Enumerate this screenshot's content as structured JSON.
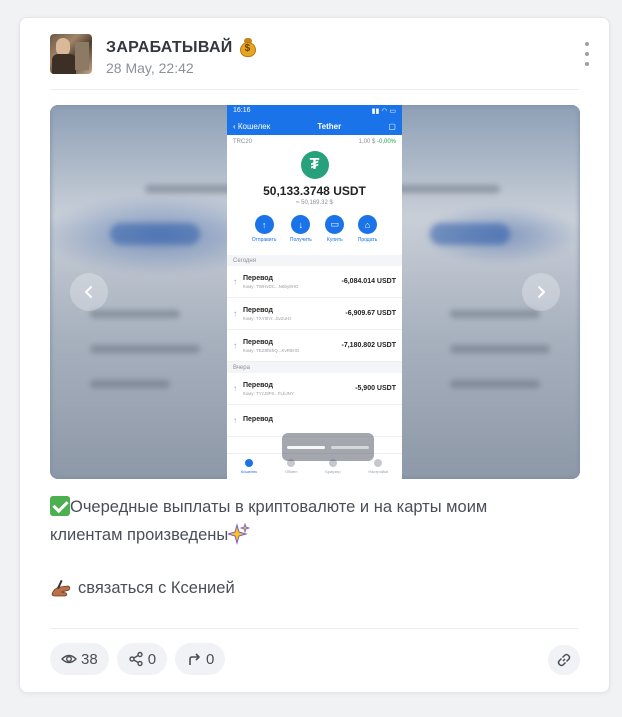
{
  "post": {
    "channel_name": "ЗАРАБАТЫВАЙ",
    "date": "28 May, 22:42",
    "text_line": "Очередные выплаты в криптовалюте и на карты моим клиентам произведены",
    "contact_text": "связаться с Ксенией"
  },
  "media": {
    "phone": {
      "time": "16:16",
      "back_label": "Кошелек",
      "title": "Tether",
      "network": "TRC20",
      "price": "1,00 $",
      "change": "-0,00%",
      "coin_symbol": "₮",
      "balance": "50,133.3748 USDT",
      "balance_fiat": "≈ 50,169.32 $",
      "actions": [
        "Отправить",
        "Получить",
        "Купить",
        "Продать"
      ],
      "section_today": "Сегодня",
      "section_yesterday": "Вчера",
      "transactions": [
        {
          "title": "Перевод",
          "sub": "Кому: TWHvDC...N6by8HG",
          "amount": "-6,084.014 USDT"
        },
        {
          "title": "Перевод",
          "sub": "Кому: TXY5hY...bvZuHz",
          "amount": "-6,909.67 USDT"
        },
        {
          "title": "Перевод",
          "sub": "Кому: TEZ8hkhQ...KvR8HG",
          "amount": "-7,180.802 USDT"
        },
        {
          "title": "Перевод",
          "sub": "Кому: TYzJ8F6...FLbJNY",
          "amount": "-5,900 USDT"
        },
        {
          "title": "Перевод",
          "sub": "",
          "amount": ""
        }
      ],
      "tabs": [
        "Кошелек",
        "Обмен",
        "Браузер",
        "Настройки"
      ]
    }
  },
  "stats": {
    "views": "38",
    "shares": "0",
    "forwards": "0"
  },
  "colors": {
    "accent": "#1a73e8",
    "check": "#4caf50",
    "tether": "#26a17b"
  }
}
